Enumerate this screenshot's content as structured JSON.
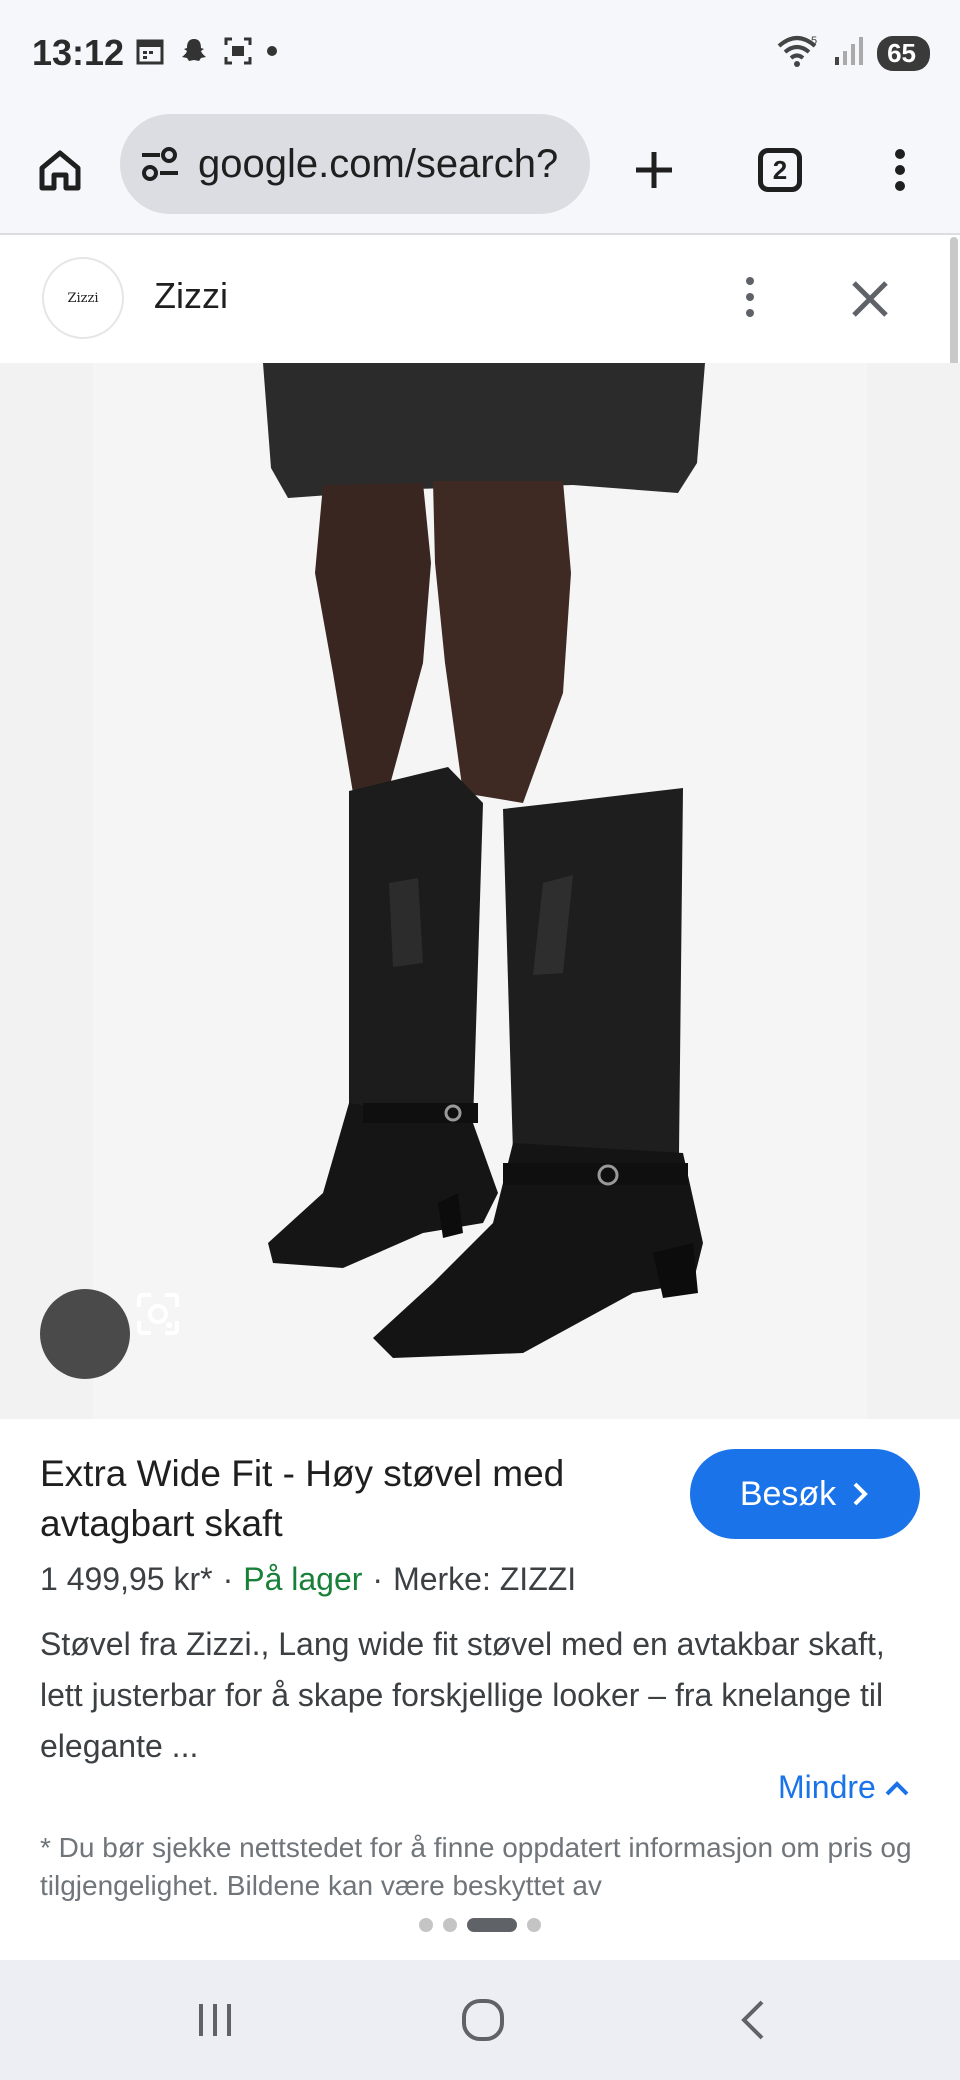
{
  "status_bar": {
    "time": "13:12",
    "battery": "65",
    "icons": [
      "calendar-icon",
      "snapchat-icon",
      "screenshot-icon",
      "dot-icon",
      "wifi-icon",
      "signal-icon",
      "battery-icon"
    ]
  },
  "browser": {
    "url": "google.com/search?",
    "tab_count": "2",
    "icons": [
      "home-icon",
      "site-settings-icon",
      "plus-icon",
      "tabs-icon",
      "more-vert-icon"
    ]
  },
  "sheet": {
    "site_logo_text": "Zizzi",
    "site_name": "Zizzi"
  },
  "product": {
    "title": "Extra Wide Fit - Høy støvel med avtagbart skaft",
    "visit_label": "Besøk",
    "price": "1 499,95 kr*",
    "stock": "På lager",
    "separator": "·",
    "brand": "Merke: ZIZZI",
    "description": "Støvel fra Zizzi., Lang wide fit støvel med en avtakbar skaft, lett justerbar for å skape forskjellige looker – fra knelange til elegante ...",
    "less_label": "Mindre",
    "disclaimer": "* Du bør sjekke nettstedet for å finne oppdatert informasjon om pris og tilgjengelighet. Bildene kan være beskyttet av"
  },
  "carousel": {
    "count": 4,
    "active_index": 2
  },
  "colors": {
    "accent": "#1a73e8",
    "stock_green": "#188038",
    "toolbar_bg": "#f6f7fb"
  }
}
